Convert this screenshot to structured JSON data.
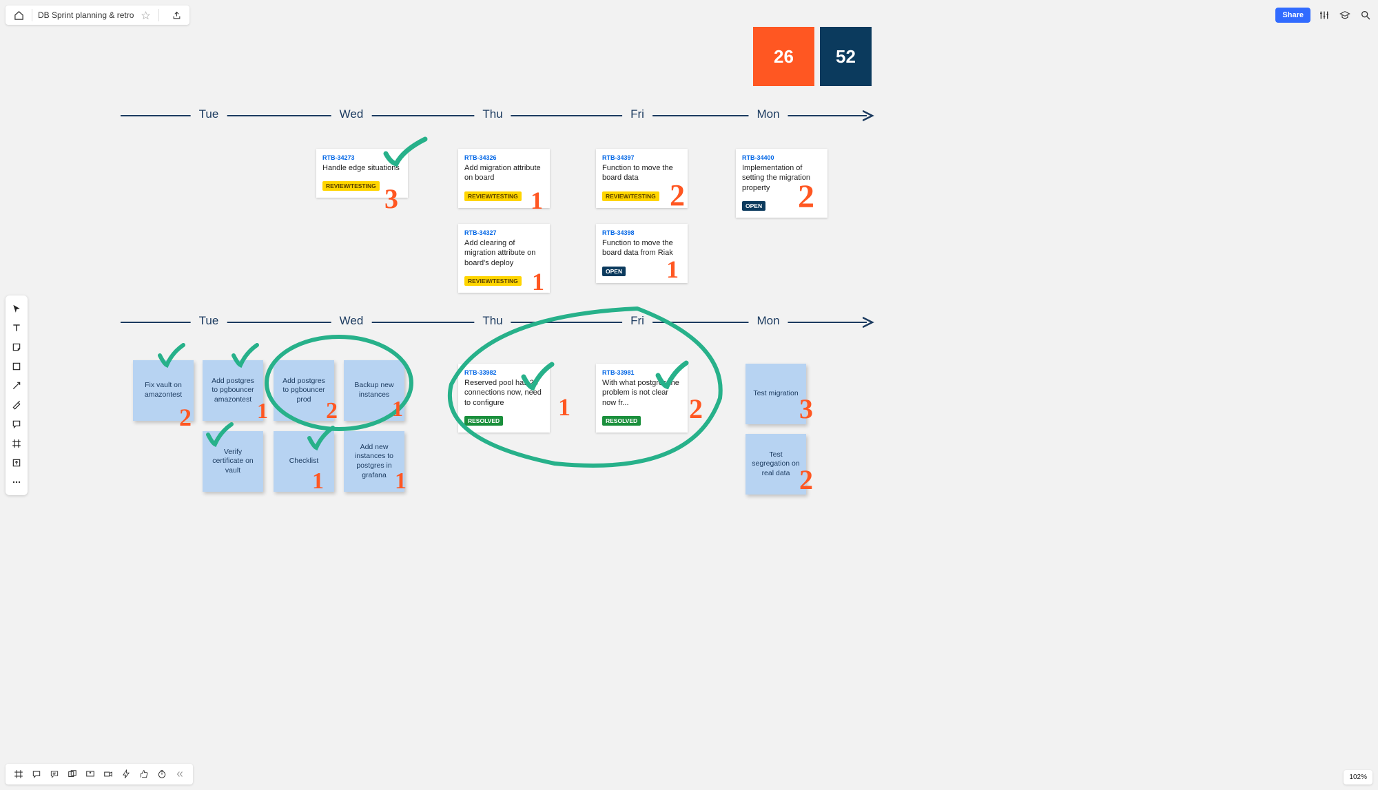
{
  "header": {
    "board_title": "DB Sprint planning & retro",
    "share_label": "Share"
  },
  "zoom": "102%",
  "counters": {
    "orange": "26",
    "navy": "52"
  },
  "days": [
    "Tue",
    "Wed",
    "Thu",
    "Fri",
    "Mon"
  ],
  "jira_row1": [
    {
      "id": "RTB-34273",
      "title": "Handle edge situations",
      "status": "REVIEW/TESTING",
      "status_kind": "review"
    },
    {
      "id": "RTB-34326",
      "title": "Add migration attribute on board",
      "status": "REVIEW/TESTING",
      "status_kind": "review"
    },
    {
      "id": "RTB-34397",
      "title": "Function to move the board data",
      "status": "REVIEW/TESTING",
      "status_kind": "review"
    },
    {
      "id": "RTB-34400",
      "title": "Implementation of setting the migration property",
      "status": "OPEN",
      "status_kind": "open"
    }
  ],
  "jira_row1b": [
    {
      "id": "RTB-34327",
      "title": "Add clearing of migration attribute on board's deploy",
      "status": "REVIEW/TESTING",
      "status_kind": "review"
    },
    {
      "id": "RTB-34398",
      "title": "Function to move the board data from Riak",
      "status": "OPEN",
      "status_kind": "open"
    }
  ],
  "jira_row2": [
    {
      "id": "RTB-33982",
      "title": "Reserved pool has 20 connections now, need to configure",
      "status": "RESOLVED",
      "status_kind": "resolved"
    },
    {
      "id": "RTB-33981",
      "title": "With what postgres the problem is not clear now fr...",
      "status": "RESOLVED",
      "status_kind": "resolved"
    }
  ],
  "stickies_top": [
    "Fix vault on amazontest",
    "Add postgres to pgbouncer amazontest",
    "Add postgres to pgbouncer prod",
    "Backup new instances"
  ],
  "stickies_bottom": [
    "Verify certificate on vault",
    "Checklist",
    "Add new instances to postgres in grafana"
  ],
  "stickies_right": [
    "Test migration",
    "Test segregation on real data"
  ],
  "hand_numbers_row1": [
    "3",
    "1",
    "2",
    "2",
    "1",
    "1"
  ],
  "hand_numbers_row2": [
    "2",
    "1",
    "2",
    "1",
    "1",
    "1",
    "1",
    "2",
    "3",
    "2"
  ]
}
